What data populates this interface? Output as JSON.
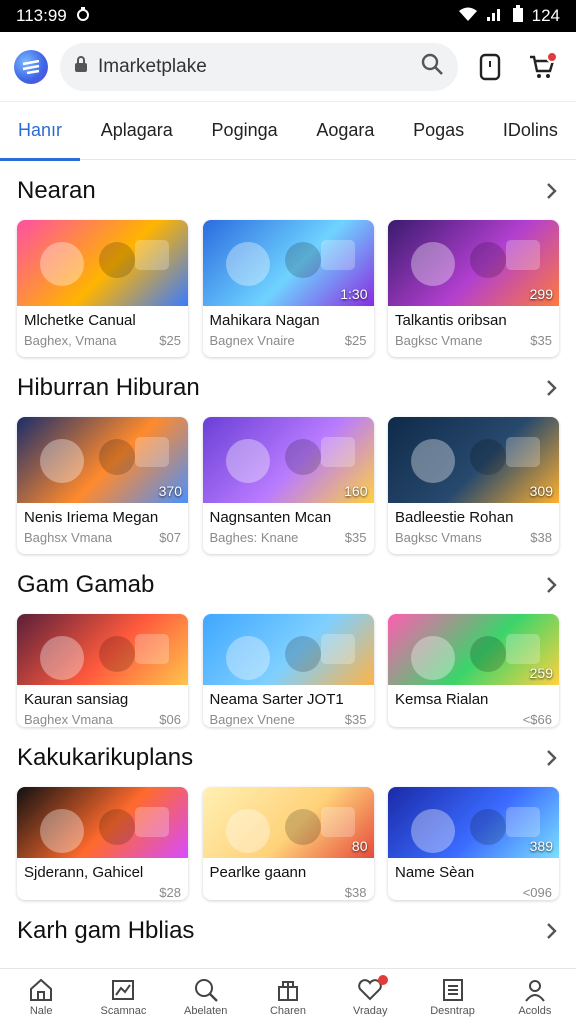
{
  "status": {
    "time": "113:99",
    "battery": "124"
  },
  "search": {
    "text": "Imarketplake"
  },
  "tabs": [
    "Hanır",
    "Aplagara",
    "Poginga",
    "Aogara",
    "Pogas",
    "IDolins"
  ],
  "sections": [
    {
      "title": "Nearan",
      "cards": [
        {
          "thumb_label": "",
          "title": "Mlchetke Canual",
          "sub": "Baghex, Vmana",
          "price": "$25",
          "bg": [
            "#ff4fa3",
            "#ffb400",
            "#3a7bff"
          ]
        },
        {
          "thumb_label": "1:30",
          "title": "Mahikara Nagan",
          "sub": "Bagnex Vnaire",
          "price": "$25",
          "bg": [
            "#2b6be0",
            "#6fd3ff",
            "#8a2be2"
          ]
        },
        {
          "thumb_label": "299",
          "title": "Talkantis oribsan",
          "sub": "Bagksc Vmane",
          "price": "$35",
          "bg": [
            "#3a1b6e",
            "#b23fcf",
            "#ff7a3d"
          ]
        }
      ]
    },
    {
      "title": "Hiburran Hiburan",
      "cards": [
        {
          "thumb_label": "370",
          "title": "Nenis Iriema Megan",
          "sub": "Baghsx Vmana",
          "price": "$07",
          "bg": [
            "#1b2d6b",
            "#ff8a2d",
            "#4a90ff"
          ]
        },
        {
          "thumb_label": "160",
          "title": "Nagnsanten Mcan",
          "sub": "Baghes: Knane",
          "price": "$35",
          "bg": [
            "#6a3fd6",
            "#b97bff",
            "#ffcf40"
          ]
        },
        {
          "thumb_label": "309",
          "title": "Badleestie Rohan",
          "sub": "Bagksc Vmans",
          "price": "$38",
          "bg": [
            "#0f2a4a",
            "#27496d",
            "#ffb02e"
          ]
        }
      ]
    },
    {
      "title": "Gam Gamab",
      "cards": [
        {
          "thumb_label": "",
          "title": "Kauran sansiag",
          "sub": "Baghex Vmana",
          "price": "$06",
          "bg": [
            "#5a1f3a",
            "#ff5a3d",
            "#ffc44d"
          ],
          "short": true
        },
        {
          "thumb_label": "",
          "title": "Neama Sarter JOT1",
          "sub": "Bagnex Vnene",
          "price": "$35",
          "bg": [
            "#3fa7ff",
            "#7fd0ff",
            "#ffb347"
          ],
          "short": true
        },
        {
          "thumb_label": "259",
          "title": "Kemsa Rialan",
          "sub": "",
          "price": "<$66",
          "bg": [
            "#ff5db1",
            "#3bd46b",
            "#ffd23f"
          ],
          "short": true
        }
      ]
    },
    {
      "title": "Kakukarikuplans",
      "cards": [
        {
          "thumb_label": "",
          "title": "Sjderann, Gahicel",
          "sub": "",
          "price": "$28",
          "bg": [
            "#111111",
            "#ff6a2d",
            "#d64cff"
          ],
          "short": true
        },
        {
          "thumb_label": "80",
          "title": "Pearlke gaann",
          "sub": "",
          "price": "$38",
          "bg": [
            "#fff0b3",
            "#ffd27a",
            "#e64a3b"
          ],
          "short": true
        },
        {
          "thumb_label": "389",
          "title": "Name Sèan",
          "sub": "",
          "price": "<096",
          "bg": [
            "#1a2aa8",
            "#3b6bff",
            "#7be0ff"
          ],
          "short": true
        }
      ]
    },
    {
      "title": "Karh gam Hblias",
      "cards": []
    }
  ],
  "bottom_nav": [
    "Nale",
    "Scamnac",
    "Abelaten",
    "Charen",
    "Vraday",
    "Desntrap",
    "Acolds"
  ],
  "colors": {
    "accent": "#2a6cd6",
    "badge": "#e23b3b"
  }
}
